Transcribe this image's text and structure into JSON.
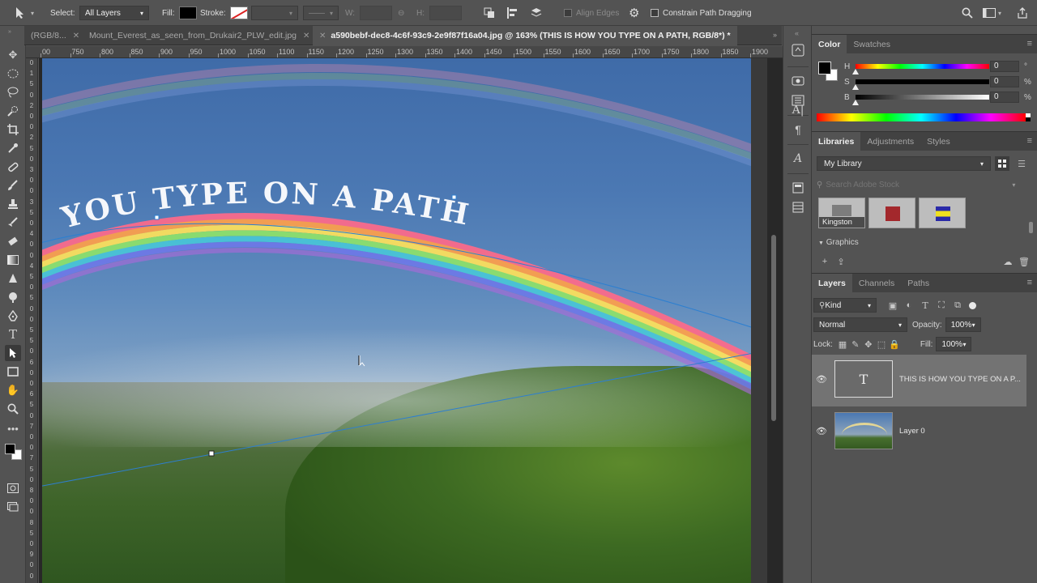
{
  "options_bar": {
    "select_label": "Select:",
    "select_value": "All Layers",
    "fill_label": "Fill:",
    "stroke_label": "Stroke:",
    "w_label": "W:",
    "h_label": "H:",
    "align_edges_label": "Align Edges",
    "constrain_label": "Constrain Path Dragging"
  },
  "tabs": [
    {
      "label": "(RGB/8...",
      "close": "✕"
    },
    {
      "label": "Mount_Everest_as_seen_from_Drukair2_PLW_edit.jpg",
      "close": "✕"
    },
    {
      "label": "a590bebf-dec8-4c6f-93c9-2e9f87f16a04.jpg @ 163% (THIS IS HOW YOU TYPE ON A PATH, RGB/8*) *",
      "close": "✕"
    }
  ],
  "ruler_h": [
    "00",
    "750",
    "800",
    "850",
    "900",
    "950",
    "1000",
    "1050",
    "1100",
    "1150",
    "1200",
    "1250",
    "1300",
    "1350",
    "1400",
    "1450",
    "1500",
    "1550",
    "1600",
    "1650",
    "1700",
    "1750",
    "1800",
    "1850",
    "1900"
  ],
  "ruler_v": [
    "0",
    "1",
    "5",
    "0",
    "2",
    "0",
    "0",
    "2",
    "5",
    "0",
    "3",
    "0",
    "0",
    "3",
    "5",
    "0",
    "4",
    "0",
    "0",
    "4",
    "5",
    "0",
    "5",
    "0",
    "0",
    "5",
    "5",
    "0",
    "6",
    "0",
    "0",
    "6",
    "5",
    "0",
    "7",
    "0",
    "0",
    "7",
    "5",
    "0",
    "8",
    "0",
    "0",
    "8",
    "5",
    "0",
    "9",
    "0",
    "0"
  ],
  "canvas": {
    "path_text": "YOU TYPE ON A PATH"
  },
  "color_panel": {
    "tabs": [
      "Color",
      "Swatches"
    ],
    "sliders": [
      {
        "letter": "H",
        "value": "0",
        "unit": "°"
      },
      {
        "letter": "S",
        "value": "0",
        "unit": "%"
      },
      {
        "letter": "B",
        "value": "0",
        "unit": "%"
      }
    ]
  },
  "libraries_panel": {
    "tabs": [
      "Libraries",
      "Adjustments",
      "Styles"
    ],
    "library_select": "My Library",
    "search_placeholder": "Search Adobe Stock",
    "thumb_label": "Kingston",
    "graphics_label": "Graphics"
  },
  "layers_panel": {
    "tabs": [
      "Layers",
      "Channels",
      "Paths"
    ],
    "filter_label": "Kind",
    "blend_mode": "Normal",
    "opacity_label": "Opacity:",
    "opacity_value": "100%",
    "lock_label": "Lock:",
    "fill_label": "Fill:",
    "fill_value": "100%",
    "layers": [
      {
        "name": "THIS IS HOW YOU TYPE ON A P...",
        "type_glyph": "T"
      },
      {
        "name": "Layer 0"
      }
    ]
  }
}
